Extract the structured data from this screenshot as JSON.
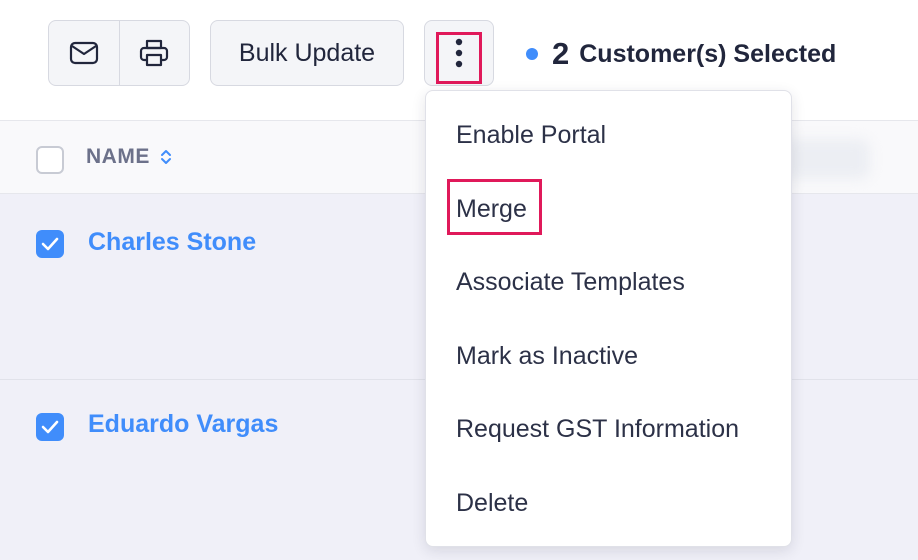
{
  "toolbar": {
    "email_icon": "envelope-icon",
    "print_icon": "printer-icon",
    "bulk_update_label": "Bulk Update",
    "more_icon": "vertical-ellipsis-icon",
    "selected_count": "2",
    "selected_label": "Customer(s) Selected",
    "status_dot_color": "#408dfb",
    "highlight_color": "#e0195a"
  },
  "table": {
    "header": {
      "name_label": "NAME",
      "sort_icon": "sort-updown-icon"
    },
    "rows": [
      {
        "name": "Charles Stone",
        "checked": true
      },
      {
        "name": "Eduardo Vargas",
        "checked": true
      }
    ],
    "link_color": "#408dfb",
    "row_selected_bg": "#f0f0f8"
  },
  "menu": {
    "items": [
      {
        "label": "Enable Portal"
      },
      {
        "label": "Merge",
        "highlighted": true
      },
      {
        "label": "Associate Templates"
      },
      {
        "label": "Mark as Inactive"
      },
      {
        "label": "Request GST Information"
      },
      {
        "label": "Delete"
      }
    ]
  }
}
